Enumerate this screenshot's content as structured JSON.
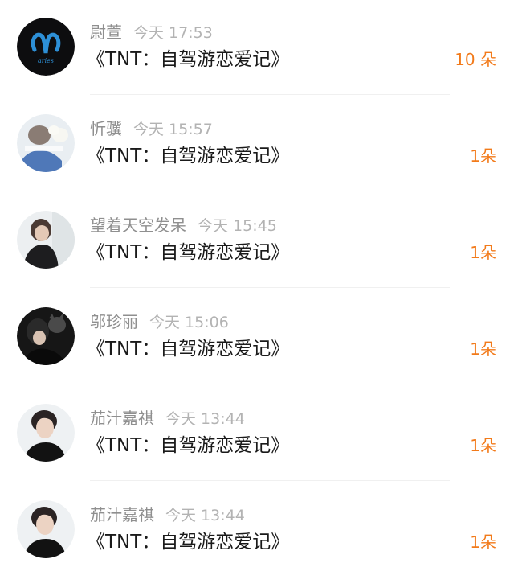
{
  "colors": {
    "count_accent": "#f27a1a",
    "name_text": "#8f8f8f",
    "time_text": "#b3b3b3",
    "title_text": "#1a1a1a"
  },
  "entries": [
    {
      "name": "尉萱",
      "time": "今天 17:53",
      "title": "《TNT：自驾游恋爱记》",
      "count": "10 朵",
      "avatar_icon": "aries-logo-avatar",
      "avatar_label": "aries"
    },
    {
      "name": "忻骥",
      "time": "今天 15:57",
      "title": "《TNT：自驾游恋爱记》",
      "count": "1朵",
      "avatar_icon": "photo-avatar"
    },
    {
      "name": "望着天空发呆",
      "time": "今天 15:45",
      "title": "《TNT：自驾游恋爱记》",
      "count": "1朵",
      "avatar_icon": "photo-avatar"
    },
    {
      "name": "邬珍丽",
      "time": "今天 15:06",
      "title": "《TNT：自驾游恋爱记》",
      "count": "1朵",
      "avatar_icon": "photo-avatar"
    },
    {
      "name": "茄汁嘉祺",
      "time": "今天 13:44",
      "title": "《TNT：自驾游恋爱记》",
      "count": "1朵",
      "avatar_icon": "photo-avatar"
    },
    {
      "name": "茄汁嘉祺",
      "time": "今天 13:44",
      "title": "《TNT：自驾游恋爱记》",
      "count": "1朵",
      "avatar_icon": "photo-avatar"
    }
  ]
}
